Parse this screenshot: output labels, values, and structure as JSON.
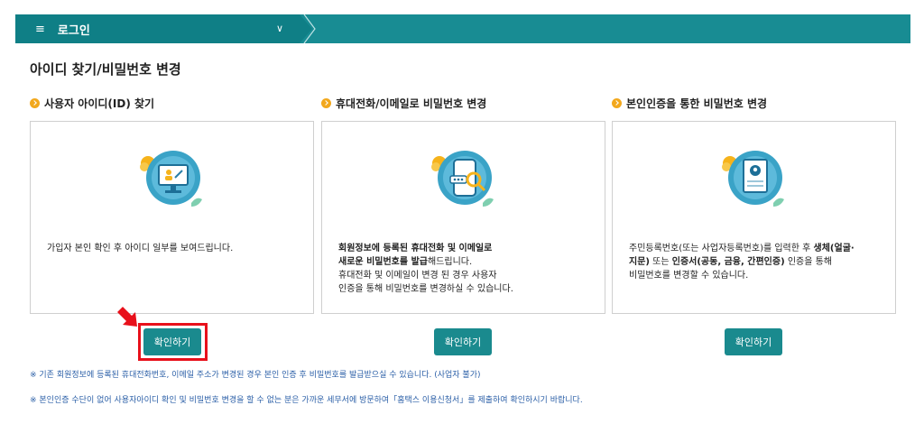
{
  "header": {
    "menu_icon": "≡",
    "menu_label": "로그인",
    "dropdown_icon": "∨"
  },
  "page_title": "아이디 찾기/비밀번호 변경",
  "sections": [
    {
      "title": "사용자 아이디(ID) 찾기",
      "desc_lines": [
        "가입자 본인 확인 후 아이디 일부를 보여드립니다."
      ],
      "button": "확인하기",
      "icon": "monitor-id-icon"
    },
    {
      "title": "휴대전화/이메일로 비밀번호 변경",
      "desc_bold_1": "회원정보에 등록된 휴대전화 및 이메일로",
      "desc_bold_2": "새로운 비밀번호를 발급",
      "desc_rest_2": "해드립니다.",
      "desc_3": "휴대전화 및 이메일이 변경 된 경우 사용자",
      "desc_4": "인증을 통해 비밀번호를 변경하실 수 있습니다.",
      "button": "확인하기",
      "icon": "phone-password-icon"
    },
    {
      "title": "본인인증을 통한 비밀번호 변경",
      "desc_1a": "주민등록번호(또는 사업자등록번호)를 입력한 후 ",
      "desc_1b": "생체(얼굴·",
      "desc_2a": "지문)",
      "desc_2b": " 또는 ",
      "desc_2c": "인증서(공동, 금융, 간편인증)",
      "desc_2d": " 인증을 통해",
      "desc_3": "비밀번호를 변경할 수 있습니다.",
      "button": "확인하기",
      "icon": "certificate-icon"
    }
  ],
  "notes": [
    "※ 기존 회원정보에 등록된 휴대전화번호, 이메일 주소가 변경된 경우 본인 인증 후 비밀번호를 발급받으실 수 있습니다. (사업자 불가)",
    "※ 본인인증 수단이 없어 사용자아이디 확인 및 비밀번호 변경을 할 수 없는 분은 가까운 세무서에 방문하여「홈택스 이용신청서」를 제출하여 확인하시기 바랍니다."
  ],
  "colors": {
    "header": "#188c93",
    "button": "#1a8a8e",
    "bullet": "#f2a81d",
    "highlight": "#e8101b",
    "note": "#2b5fa7"
  }
}
